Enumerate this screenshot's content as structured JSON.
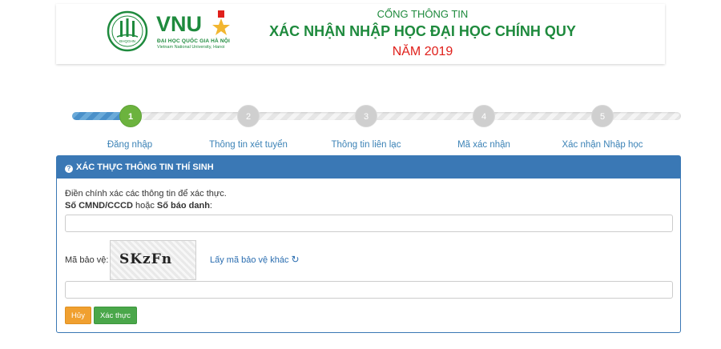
{
  "header": {
    "logo": {
      "mark": "VNU",
      "emblem_text": "ĐHQGHN",
      "sub_vi": "ĐẠI HỌC QUỐC GIA HÀ NỘI",
      "sub_en": "Vietnam National University, Hanoi",
      "icon": "star-medal-icon"
    },
    "line1": "CỔNG THÔNG TIN",
    "line2": "XÁC NHẬN NHẬP HỌC ĐẠI HỌC CHÍNH QUY",
    "line3": "NĂM 2019"
  },
  "stepper": {
    "progress_fraction": 0.1,
    "steps": [
      {
        "number": "1",
        "label": "Đăng nhập",
        "active": true
      },
      {
        "number": "2",
        "label": "Thông tin xét tuyển",
        "active": false
      },
      {
        "number": "3",
        "label": "Thông tin liên lạc",
        "active": false
      },
      {
        "number": "4",
        "label": "Mã xác nhận",
        "active": false
      },
      {
        "number": "5",
        "label": "Xác nhận Nhập học",
        "active": false
      }
    ]
  },
  "panel": {
    "title": "XÁC THỰC THÔNG TIN THÍ SINH",
    "icon": "question-circle-icon",
    "instruction": "Điền chính xác các thông tin để xác thực.",
    "id_label_part1": "Số CMND/CCCD",
    "id_label_part2": " hoặc ",
    "id_label_part3": "Số báo danh",
    "id_label_part4": ":",
    "id_value": "",
    "captcha_label": "Mã bảo vệ:",
    "captcha_text": "SKzFn",
    "refresh_link": "Lấy mã bảo vệ khác",
    "refresh_icon": "refresh-icon",
    "captcha_value": "",
    "cancel_button": "Hủy",
    "submit_button": "Xác thực"
  },
  "colors": {
    "brand_green": "#1e8a3d",
    "year_red": "#e0201b",
    "panel_blue": "#3a78b5",
    "active_step": "#6cb33e",
    "cancel_orange": "#f0a030",
    "submit_green": "#4aa74a"
  }
}
